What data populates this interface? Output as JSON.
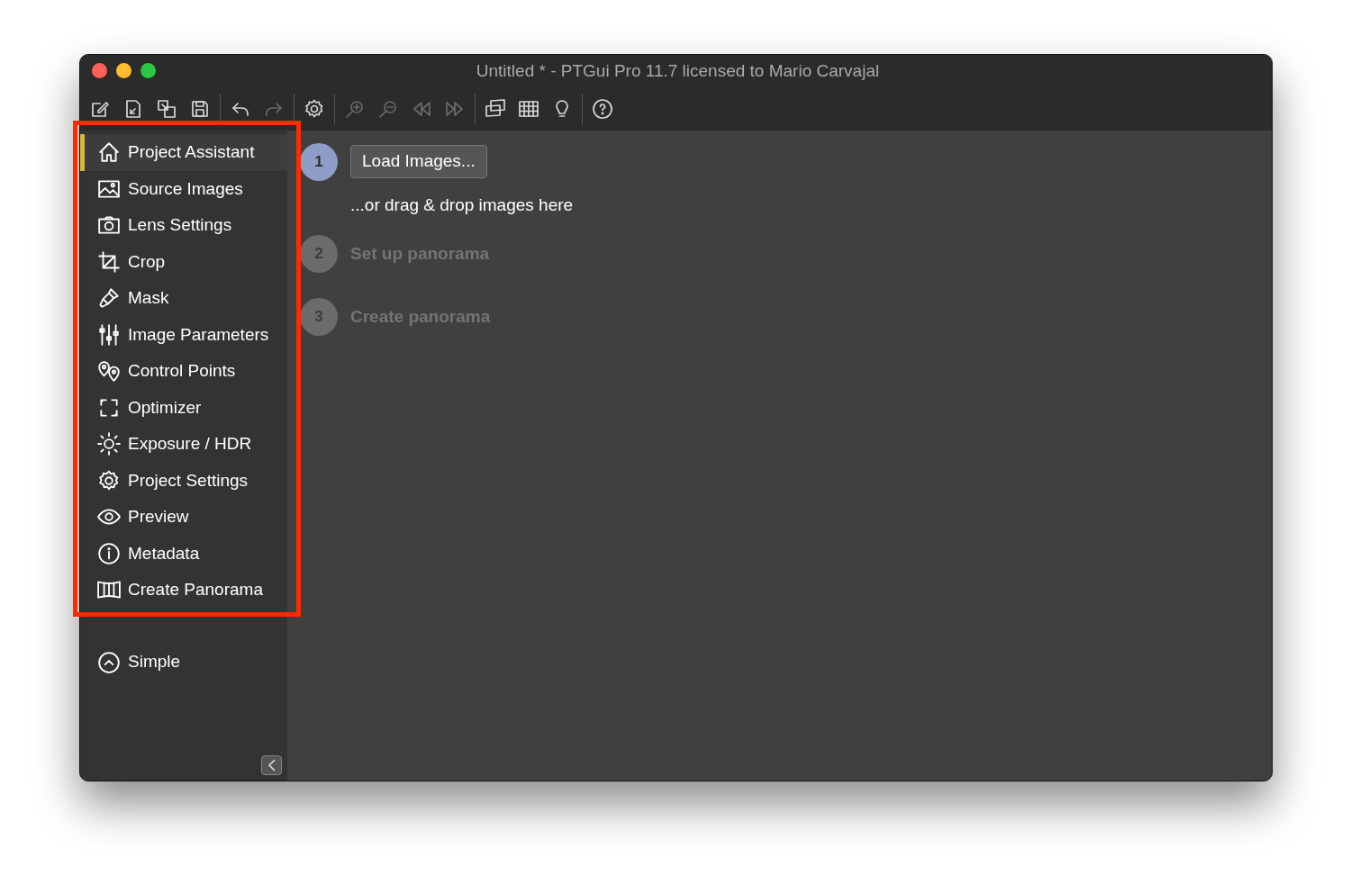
{
  "window": {
    "title": "Untitled * - PTGui Pro 11.7 licensed to Mario Carvajal"
  },
  "toolbar": {
    "groups": [
      [
        {
          "kind": "new",
          "disabled": false
        },
        {
          "kind": "open",
          "disabled": false
        },
        {
          "kind": "duplicate",
          "disabled": false
        },
        {
          "kind": "save",
          "disabled": false
        }
      ],
      [
        {
          "kind": "undo",
          "disabled": false
        },
        {
          "kind": "redo",
          "disabled": true
        }
      ],
      [
        {
          "kind": "settings",
          "disabled": false
        }
      ],
      [
        {
          "kind": "zoom-in",
          "disabled": true
        },
        {
          "kind": "zoom-out",
          "disabled": true
        },
        {
          "kind": "rewind",
          "disabled": true
        },
        {
          "kind": "forward",
          "disabled": true
        }
      ],
      [
        {
          "kind": "panorama",
          "disabled": false
        },
        {
          "kind": "grid",
          "disabled": false
        },
        {
          "kind": "bulb",
          "disabled": false
        }
      ],
      [
        {
          "kind": "help",
          "disabled": false
        }
      ]
    ]
  },
  "sidebar": {
    "highlighted": true,
    "items": [
      {
        "kind": "home",
        "label": "Project Assistant",
        "selected": true
      },
      {
        "kind": "image",
        "label": "Source Images",
        "selected": false
      },
      {
        "kind": "camera",
        "label": "Lens Settings",
        "selected": false
      },
      {
        "kind": "crop",
        "label": "Crop",
        "selected": false
      },
      {
        "kind": "brush",
        "label": "Mask",
        "selected": false
      },
      {
        "kind": "sliders",
        "label": "Image Parameters",
        "selected": false
      },
      {
        "kind": "pins",
        "label": "Control Points",
        "selected": false
      },
      {
        "kind": "optimize",
        "label": "Optimizer",
        "selected": false
      },
      {
        "kind": "sun",
        "label": "Exposure / HDR",
        "selected": false
      },
      {
        "kind": "gear",
        "label": "Project Settings",
        "selected": false
      },
      {
        "kind": "eye",
        "label": "Preview",
        "selected": false
      },
      {
        "kind": "info",
        "label": "Metadata",
        "selected": false
      },
      {
        "kind": "pano",
        "label": "Create Panorama",
        "selected": false
      }
    ],
    "mode": {
      "label": "Simple"
    }
  },
  "steps": [
    {
      "number": "1",
      "active": true,
      "button": "Load Images...",
      "hint": "...or drag & drop images here"
    },
    {
      "number": "2",
      "active": false,
      "label": "Set up panorama"
    },
    {
      "number": "3",
      "active": false,
      "label": "Create panorama"
    }
  ]
}
